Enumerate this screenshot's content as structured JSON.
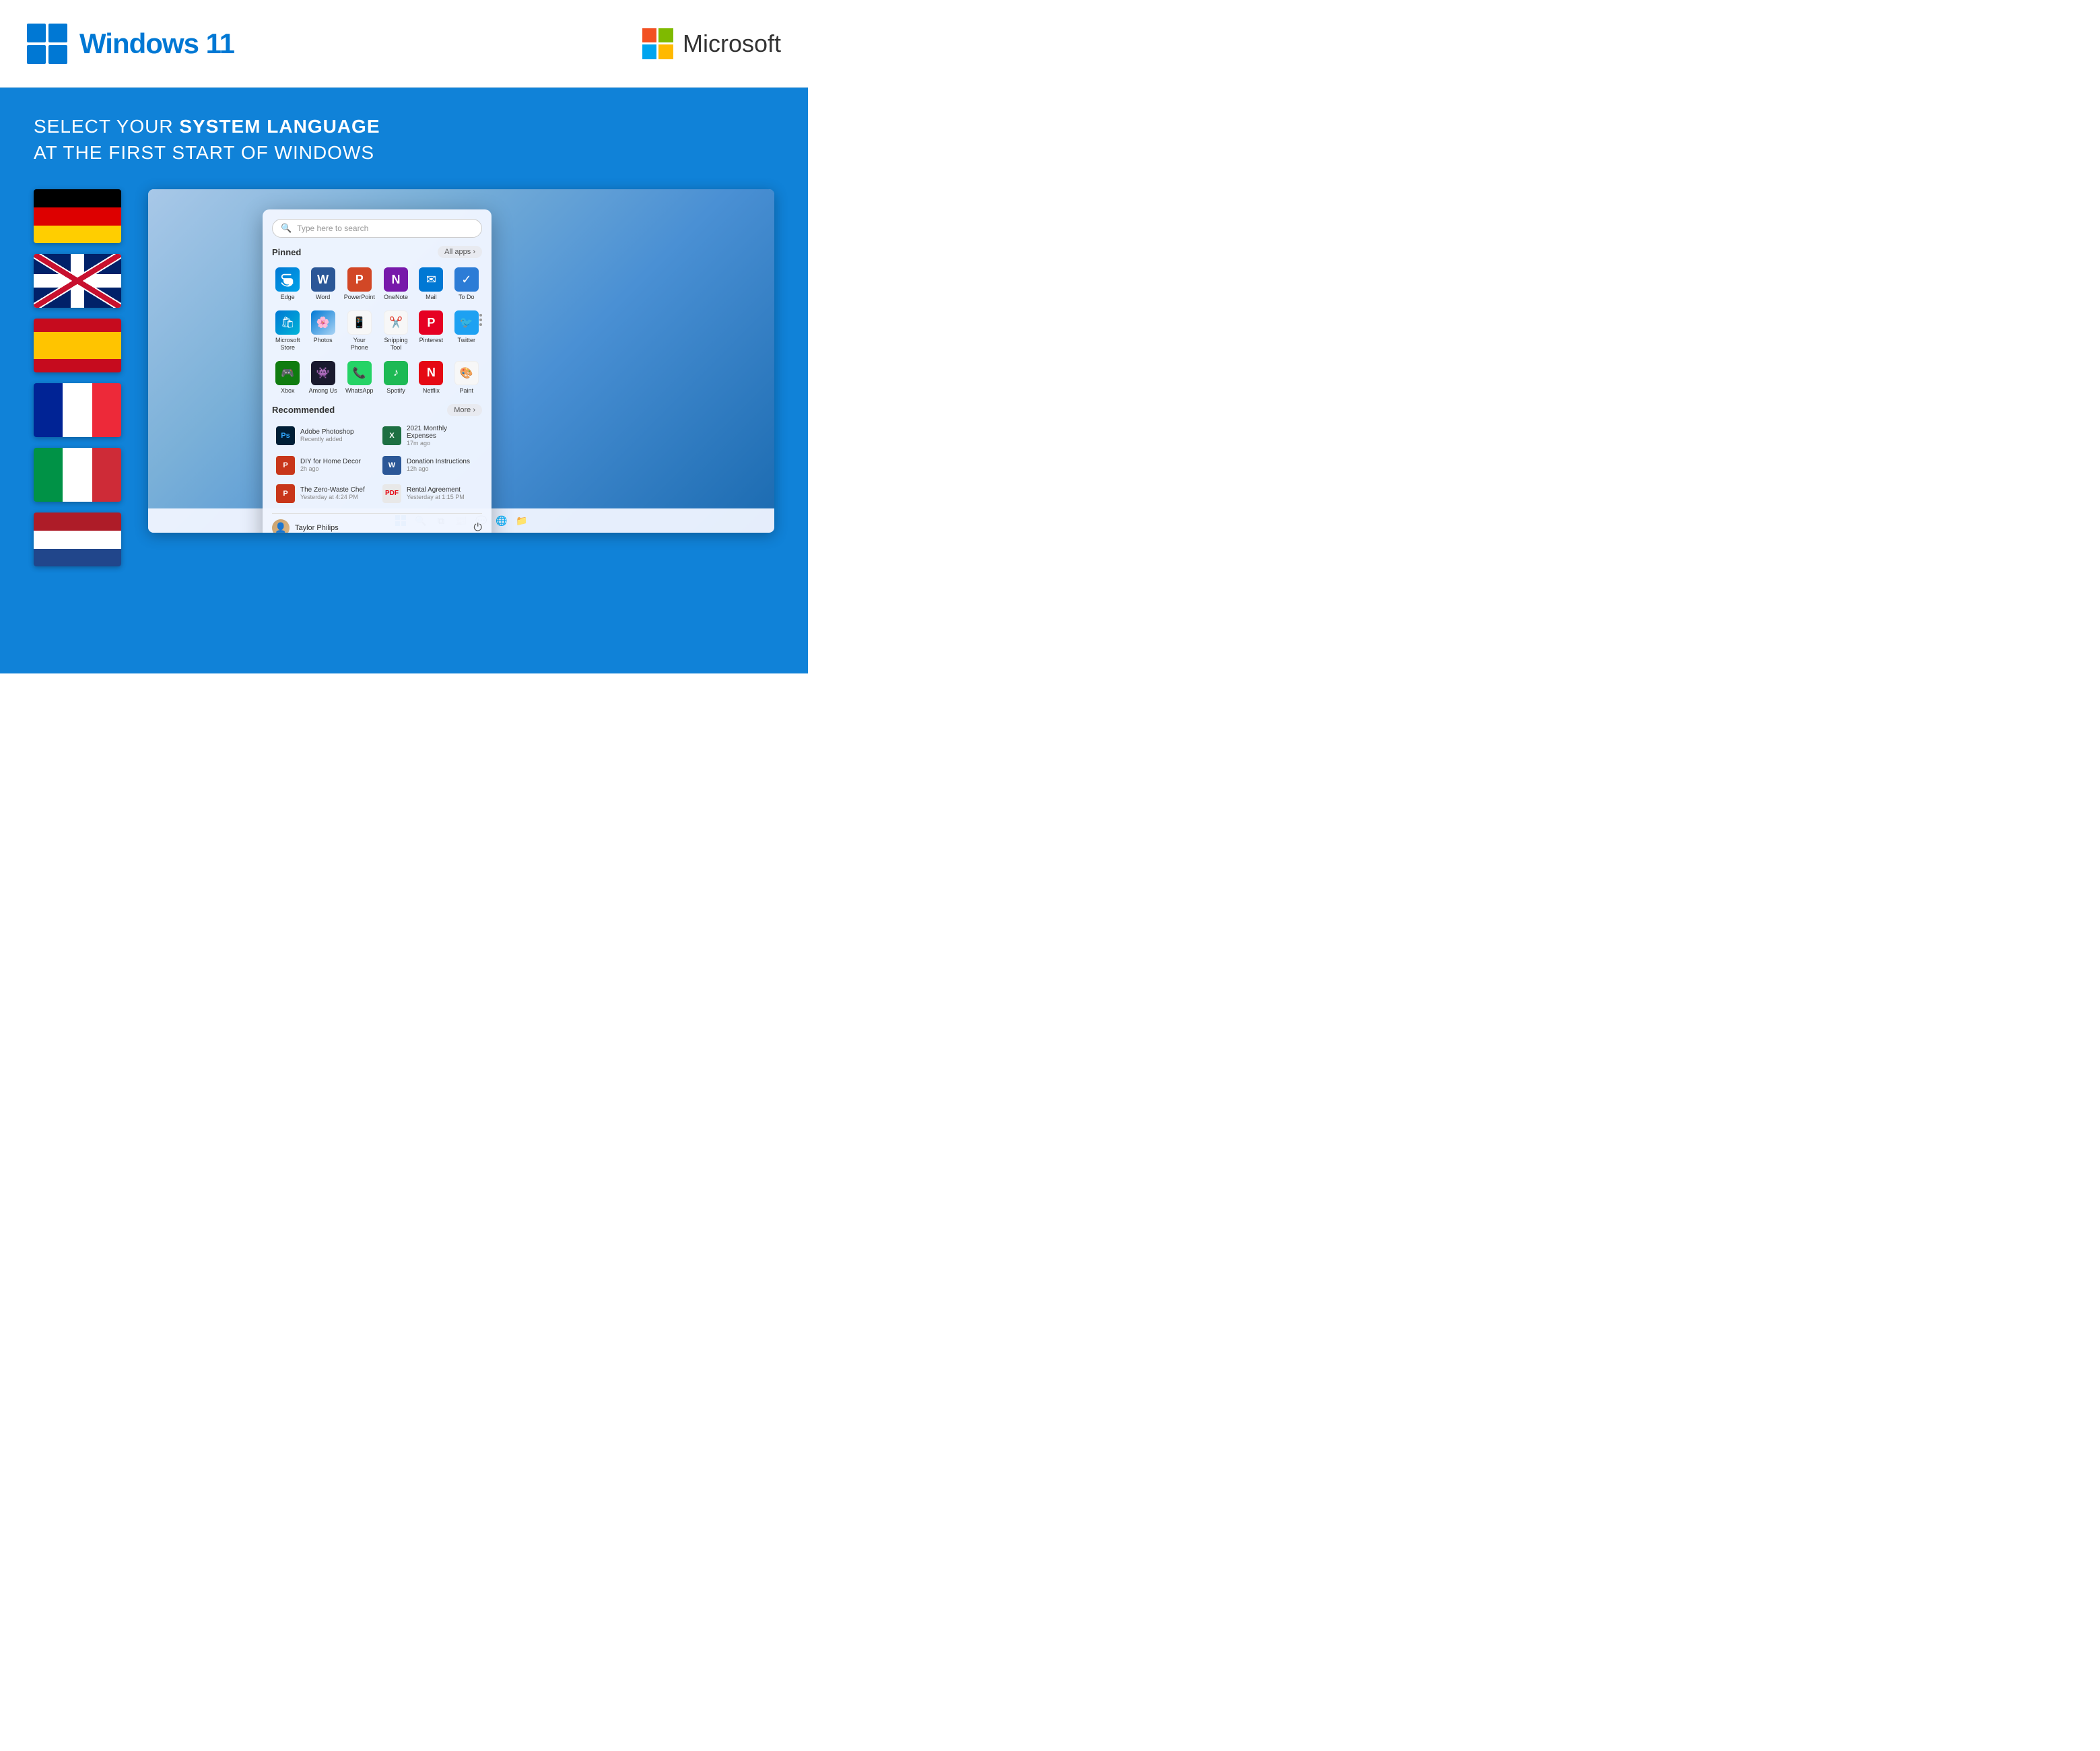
{
  "header": {
    "windows_title": "Windows ",
    "windows_version": "11",
    "microsoft_label": "Microsoft"
  },
  "headline": {
    "line1_normal": "SELECT YOUR ",
    "line1_bold": "SYSTEM LANGUAGE",
    "line2": "AT THE FIRST START OF WINDOWS"
  },
  "flags": [
    {
      "id": "de",
      "label": "German"
    },
    {
      "id": "uk",
      "label": "English"
    },
    {
      "id": "es",
      "label": "Spanish"
    },
    {
      "id": "fr",
      "label": "French"
    },
    {
      "id": "it",
      "label": "Italian"
    },
    {
      "id": "nl",
      "label": "Dutch"
    }
  ],
  "start_menu": {
    "search_placeholder": "Type here to search",
    "pinned_label": "Pinned",
    "all_apps_label": "All apps ›",
    "recommended_label": "Recommended",
    "more_label": "More ›",
    "pinned_apps": [
      {
        "name": "Edge",
        "icon": "🌐",
        "class": "icon-edge"
      },
      {
        "name": "Word",
        "icon": "W",
        "class": "icon-word"
      },
      {
        "name": "PowerPoint",
        "icon": "P",
        "class": "icon-ppt"
      },
      {
        "name": "OneNote",
        "icon": "N",
        "class": "icon-onenote"
      },
      {
        "name": "Mail",
        "icon": "✉",
        "class": "icon-mail"
      },
      {
        "name": "To Do",
        "icon": "✓",
        "class": "icon-todo"
      },
      {
        "name": "Microsoft Store",
        "icon": "🏪",
        "class": "icon-store"
      },
      {
        "name": "Photos",
        "icon": "🌻",
        "class": "icon-photos"
      },
      {
        "name": "Your Phone",
        "icon": "📱",
        "class": "icon-yourphone"
      },
      {
        "name": "Snipping Tool",
        "icon": "✂",
        "class": "icon-snipping"
      },
      {
        "name": "Pinterest",
        "icon": "P",
        "class": "icon-pinterest"
      },
      {
        "name": "Twitter",
        "icon": "🐦",
        "class": "icon-twitter"
      },
      {
        "name": "Xbox",
        "icon": "🎮",
        "class": "icon-xbox"
      },
      {
        "name": "Among Us",
        "icon": "👾",
        "class": "icon-among"
      },
      {
        "name": "WhatsApp",
        "icon": "📞",
        "class": "icon-whatsapp"
      },
      {
        "name": "Spotify",
        "icon": "♪",
        "class": "icon-spotify"
      },
      {
        "name": "Netflix",
        "icon": "N",
        "class": "icon-netflix"
      },
      {
        "name": "Paint",
        "icon": "🎨",
        "class": "icon-paint"
      }
    ],
    "recommended_items": [
      {
        "name": "Adobe Photoshop",
        "time": "Recently added",
        "icon": "Ps",
        "bg": "#001e36",
        "color": "#31a8ff"
      },
      {
        "name": "2021 Monthly Expenses",
        "time": "17m ago",
        "icon": "X",
        "bg": "#1d6f42",
        "color": "#fff"
      },
      {
        "name": "DIY for Home Decor",
        "time": "2h ago",
        "icon": "P",
        "bg": "#c8361a",
        "color": "#fff"
      },
      {
        "name": "Donation Instructions",
        "time": "12h ago",
        "icon": "W",
        "bg": "#2b5797",
        "color": "#fff"
      },
      {
        "name": "The Zero-Waste Chef",
        "time": "Yesterday at 4:24 PM",
        "icon": "P",
        "bg": "#c8361a",
        "color": "#fff"
      },
      {
        "name": "Rental Agreement",
        "time": "Yesterday at 1:15 PM",
        "icon": "📄",
        "bg": "#e8e8e8",
        "color": "#e50914"
      }
    ],
    "user_name": "Taylor Philips"
  }
}
